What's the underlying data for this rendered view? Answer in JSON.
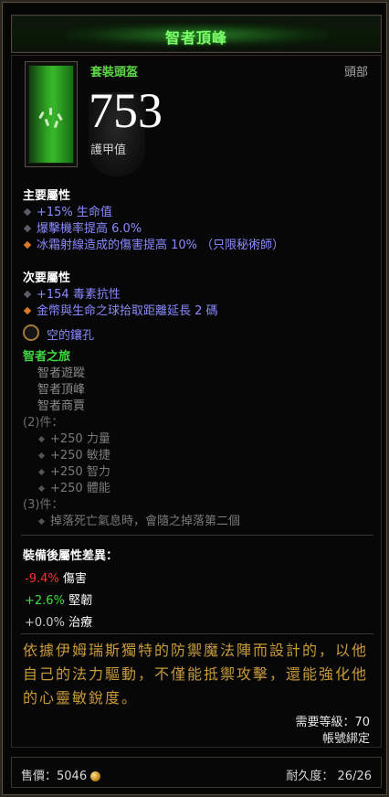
{
  "item": {
    "name": "智者頂峰",
    "type": "套裝頭盔",
    "slot": "頭部",
    "armor_value": "753",
    "armor_label": "護甲值"
  },
  "primary": {
    "title": "主要屬性",
    "lines": [
      "+15% 生命值",
      "爆擊機率提高 6.0%",
      "冰霜射線造成的傷害提高 10% （只限秘術師）"
    ]
  },
  "secondary": {
    "title": "次要屬性",
    "lines": [
      "+154 毒素抗性",
      "金幣與生命之球拾取距離延長 2 碼"
    ]
  },
  "socket": {
    "label": "空的鑲孔"
  },
  "set": {
    "name": "智者之旅",
    "items": [
      "智者遊蹤",
      "智者頂峰",
      "智者商賈"
    ],
    "tier2_label": "(2)件：",
    "tier2_bonuses": [
      "+250 力量",
      "+250 敏捷",
      "+250 智力",
      "+250 體能"
    ],
    "tier3_label": "(3)件：",
    "tier3_bonuses": [
      "掉落死亡氣息時，會隨之掉落第二個"
    ]
  },
  "compare": {
    "title": "裝備後屬性差異：",
    "rows": [
      {
        "value": "-9.4%",
        "label": "傷害"
      },
      {
        "value": "+2.6%",
        "label": "堅韌"
      },
      {
        "value": "+0.0%",
        "label": "治療"
      }
    ]
  },
  "flavor_text": "依據伊姆瑞斯獨特的防禦魔法陣而設計的，以他自己的法力驅動，不僅能抵禦攻擊，還能強化他的心靈敏銳度。",
  "requirements": {
    "level": "需要等級：70",
    "bind": "帳號綁定"
  },
  "footer": {
    "price": "售價：5046",
    "durability": "耐久度： 26/26"
  },
  "colors": {
    "set_green": "#3fd63f",
    "magic_blue": "#8a8aff",
    "legendary_orange": "#d8782a",
    "flavor_gold": "#c89a3a",
    "negative_red": "#ff3030",
    "positive_green": "#40e040"
  }
}
